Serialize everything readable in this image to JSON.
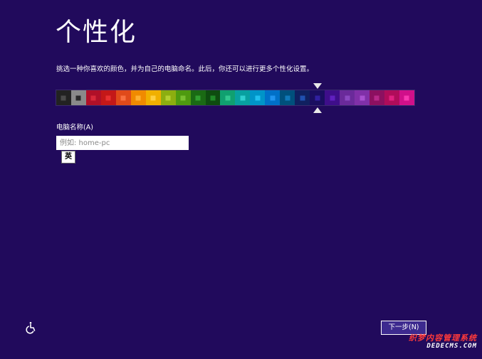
{
  "page": {
    "title": "个性化",
    "instruction": "挑选一种你喜欢的颜色，并为自己的电脑命名。此后，你还可以进行更多个性化设置。"
  },
  "colors": {
    "background": "#210a5c",
    "selected_swatch_index": 17,
    "swatches": [
      {
        "bg": "#222222",
        "inner": "#4a4a4a"
      },
      {
        "bg": "#8a8a8a",
        "inner": "#2a2a2a"
      },
      {
        "bg": "#b01028",
        "inner": "#d8283a"
      },
      {
        "bg": "#c41818",
        "inner": "#e83030"
      },
      {
        "bg": "#e04a1a",
        "inner": "#f87040"
      },
      {
        "bg": "#f08a00",
        "inner": "#ffb030"
      },
      {
        "bg": "#f0b000",
        "inner": "#ffd040"
      },
      {
        "bg": "#8cae10",
        "inner": "#b4d030"
      },
      {
        "bg": "#4e9a10",
        "inner": "#78c030"
      },
      {
        "bg": "#1a6a14",
        "inner": "#30a030"
      },
      {
        "bg": "#0e4c10",
        "inner": "#208a28"
      },
      {
        "bg": "#10a070",
        "inner": "#30c890"
      },
      {
        "bg": "#08a0a0",
        "inner": "#30d0d0"
      },
      {
        "bg": "#0094c8",
        "inner": "#20c0f0"
      },
      {
        "bg": "#0070c8",
        "inner": "#2094f0"
      },
      {
        "bg": "#00507c",
        "inner": "#1078b8"
      },
      {
        "bg": "#102060",
        "inner": "#2050b0"
      },
      {
        "bg": "#1a0e60",
        "inner": "#3020a0"
      },
      {
        "bg": "#3e0e8a",
        "inner": "#6020c0"
      },
      {
        "bg": "#6a2a9a",
        "inner": "#8a48c0"
      },
      {
        "bg": "#8030a8",
        "inner": "#a850d0"
      },
      {
        "bg": "#8c1060",
        "inner": "#b82888"
      },
      {
        "bg": "#b00c5a",
        "inner": "#e02080"
      },
      {
        "bg": "#d0108a",
        "inner": "#f838b0"
      }
    ]
  },
  "computer_name": {
    "label": "电脑名称(A)",
    "placeholder": "例如: home-pc",
    "value": ""
  },
  "ime": {
    "label": "英"
  },
  "footer": {
    "ease_of_access_icon": "ease-of-access-icon",
    "next_button_label": "下一步(N)"
  },
  "watermark": {
    "line1": "织梦内容管理系统",
    "line2": "DEDECMS.COM"
  }
}
